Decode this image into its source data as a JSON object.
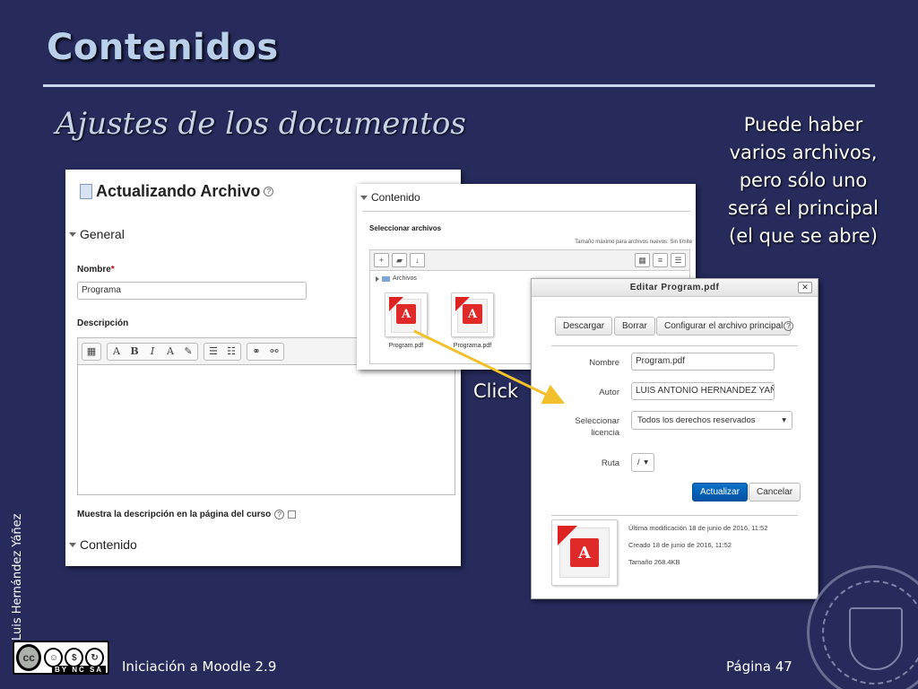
{
  "slide": {
    "title": "Contenidos",
    "subtitle": "Ajustes de los documentos",
    "side_note": "Puede haber varios archivos, pero sólo uno será el principal (el que se abre)",
    "click_label": "Click",
    "author": "Luis Hernández Yáñez",
    "footer_left": "Iniciación a Moodle 2.9",
    "footer_right": "Página 47",
    "license": {
      "cc": "cc",
      "labels": "BY NC SA"
    },
    "colors": {
      "background": "#262b5c",
      "title": "#b9cfea",
      "arrow": "#f2c02b"
    }
  },
  "main_form": {
    "heading": "Actualizando Archivo",
    "general_label": "General",
    "name_label": "Nombre",
    "required_mark": "*",
    "name_value": "Programa",
    "description_label": "Descripción",
    "toolbar_buttons": [
      "▦",
      "A",
      "B",
      "I",
      "A",
      "✎",
      "☰",
      "☷",
      "⚭",
      "⚯"
    ],
    "show_description_label": "Muestra la descripción en la página del curso",
    "content_label": "Contenido"
  },
  "file_picker": {
    "section_label": "Contenido",
    "select_label": "Seleccionar archivos",
    "max_size": "Tamaño máximo para archivos nuevos: Sin límite",
    "folder_label": "Archivos",
    "files": [
      {
        "name": "Program.pdf"
      },
      {
        "name": "Programa.pdf"
      }
    ]
  },
  "dialog": {
    "title": "Editar Program.pdf",
    "close": "✕",
    "buttons": {
      "download": "Descargar",
      "delete": "Borrar",
      "set_main": "Configurar el archivo principal"
    },
    "fields": {
      "name_label": "Nombre",
      "name_value": "Program.pdf",
      "author_label": "Autor",
      "author_value": "LUIS ANTONIO HERNANDEZ YAÑE",
      "license_label": "Seleccionar licencia",
      "license_value": "Todos los derechos reservados",
      "path_label": "Ruta",
      "path_value": "/"
    },
    "update_button": "Actualizar",
    "cancel_button": "Cancelar",
    "meta": {
      "modified": "Última modificación   18 de junio de 2016, 11:52",
      "created": "Creado   18 de junio de 2016, 11:52",
      "size": "Tamaño   268.4KB"
    }
  }
}
